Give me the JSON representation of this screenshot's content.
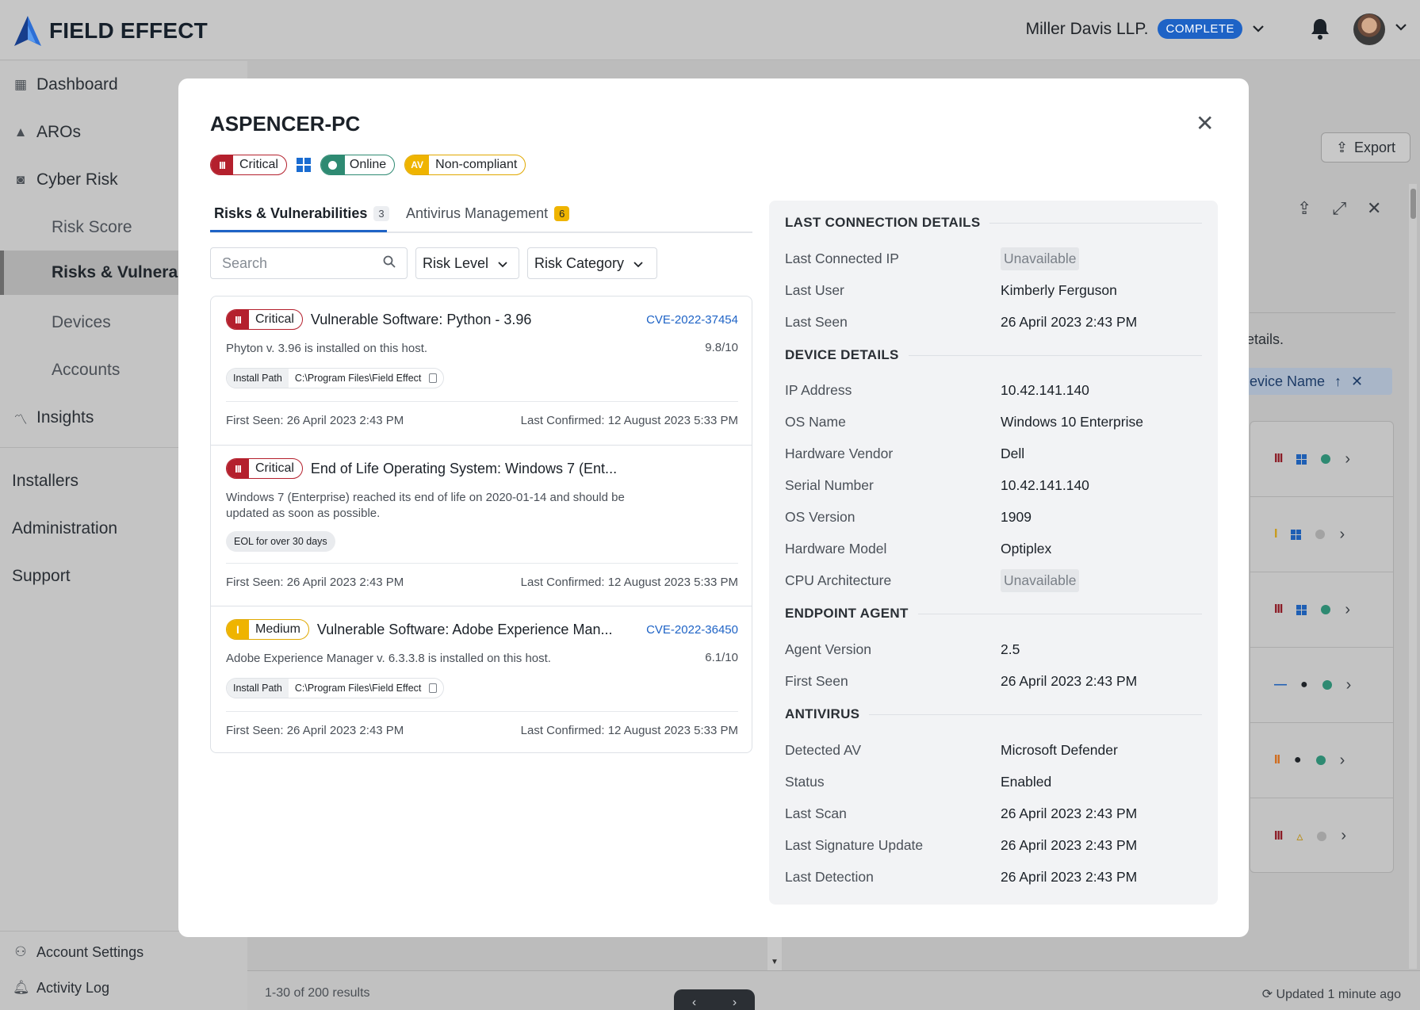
{
  "app": {
    "brand": "FIELD EFFECT",
    "org_name": "Miller Davis LLP.",
    "org_status": "COMPLETE"
  },
  "sidebar": {
    "items": [
      {
        "label": "Dashboard",
        "icon": "grid-icon"
      },
      {
        "label": "AROs",
        "icon": "aro-icon"
      },
      {
        "label": "Cyber Risk",
        "icon": "cyber-risk-icon"
      },
      {
        "label": "Risk Score"
      },
      {
        "label": "Risks & Vulnerab"
      },
      {
        "label": "Devices"
      },
      {
        "label": "Accounts"
      },
      {
        "label": "Insights",
        "icon": "trend-icon"
      },
      {
        "label": "Installers"
      },
      {
        "label": "Administration"
      },
      {
        "label": "Support"
      }
    ],
    "bottom": [
      {
        "label": "Account Settings",
        "icon": "user-icon"
      },
      {
        "label": "Activity Log",
        "icon": "bell-icon"
      }
    ]
  },
  "background": {
    "export_label": "Export",
    "details_fragment": "etails.",
    "chip_label": "evice Name",
    "results": "1-30 of 200 results",
    "updated": "Updated 1 minute ago"
  },
  "modal": {
    "title": "ASPENCER-PC",
    "badges": {
      "severity": "Critical",
      "status": "Online",
      "av_lead": "AV",
      "av_status": "Non-compliant"
    },
    "tabs": [
      {
        "label": "Risks & Vulnerabilities",
        "count": "3"
      },
      {
        "label": "Antivirus Management",
        "count": "6"
      }
    ],
    "filters": {
      "search_placeholder": "Search",
      "risk_level": "Risk Level",
      "risk_category": "Risk Category"
    },
    "risks": [
      {
        "severity": "Critical",
        "title": "Vulnerable Software: Python - 3.96",
        "cve": "CVE-2022-37454",
        "score": "9.8/10",
        "description": "Phyton v. 3.96 is installed on this host.",
        "path_key": "Install Path",
        "path_value": "C:\\Program Files\\Field Effect",
        "first_seen": "First Seen: 26 April 2023 2:43 PM",
        "last_confirmed": "Last Confirmed: 12 August 2023 5:33 PM"
      },
      {
        "severity": "Critical",
        "title": "End of Life Operating System: Windows 7 (Ent...",
        "description": "Windows 7 (Enterprise) reached its end of life on 2020-01-14 and should be updated as soon as possible.",
        "tag": "EOL for over 30 days",
        "first_seen": "First Seen: 26 April 2023 2:43 PM",
        "last_confirmed": "Last Confirmed: 12 August 2023 5:33 PM"
      },
      {
        "severity": "Medium",
        "title": "Vulnerable Software: Adobe Experience Man...",
        "cve": "CVE-2022-36450",
        "score": "6.1/10",
        "description": "Adobe Experience Manager v. 6.3.3.8 is installed on this host.",
        "path_key": "Install Path",
        "path_value": "C:\\Program Files\\Field Effect",
        "first_seen": "First Seen: 26 April 2023 2:43 PM",
        "last_confirmed": "Last Confirmed: 12 August 2023 5:33 PM"
      }
    ],
    "details": {
      "last_connection": {
        "heading": "LAST CONNECTION DETAILS",
        "rows": [
          {
            "k": "Last Connected IP",
            "v": "Unavailable"
          },
          {
            "k": "Last User",
            "v": "Kimberly Ferguson"
          },
          {
            "k": "Last Seen",
            "v": "26 April 2023 2:43 PM"
          }
        ]
      },
      "device": {
        "heading": "DEVICE DETAILS",
        "rows": [
          {
            "k": "IP Address",
            "v": "10.42.141.140"
          },
          {
            "k": "OS Name",
            "v": "Windows 10 Enterprise"
          },
          {
            "k": "Hardware Vendor",
            "v": "Dell"
          },
          {
            "k": "Serial Number",
            "v": "10.42.141.140"
          },
          {
            "k": "OS Version",
            "v": "1909"
          },
          {
            "k": "Hardware Model",
            "v": "Optiplex"
          },
          {
            "k": "CPU Architecture",
            "v": "Unavailable"
          }
        ]
      },
      "endpoint": {
        "heading": "ENDPOINT AGENT",
        "rows": [
          {
            "k": "Agent Version",
            "v": "2.5"
          },
          {
            "k": "First Seen",
            "v": "26 April 2023 2:43 PM"
          }
        ]
      },
      "antivirus": {
        "heading": "ANTIVIRUS",
        "rows": [
          {
            "k": "Detected AV",
            "v": "Microsoft Defender"
          },
          {
            "k": "Status",
            "v": "Enabled"
          },
          {
            "k": "Last Scan",
            "v": "26 April 2023 2:43 PM"
          },
          {
            "k": "Last Signature Update",
            "v": "26 April 2023 2:43 PM"
          },
          {
            "k": "Last Detection",
            "v": "26 April 2023 2:43 PM"
          }
        ]
      }
    }
  },
  "colors": {
    "critical": "#b4202d",
    "medium": "#efb400",
    "online": "#2e8a72",
    "accent": "#1e63c6"
  }
}
